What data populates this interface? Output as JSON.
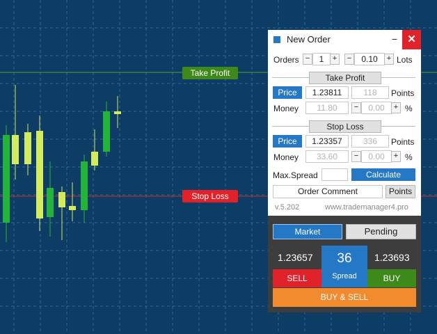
{
  "chart": {
    "background": "#0d3d64",
    "grid_color": "#2f6a92",
    "take_profit_label": "Take Profit",
    "stop_loss_label": "Stop Loss",
    "take_profit_line_color": "#4fa32d",
    "stop_loss_line_color": "#e2222a",
    "bull_color": "#22b53a",
    "bear_color": "#d4ec5c"
  },
  "panel": {
    "title": "New Order",
    "minimize_symbol": "−",
    "close_symbol": "✕",
    "orders_label": "Orders",
    "orders_value": "1",
    "lots_value": "0.10",
    "lots_label": "Lots",
    "minus": "−",
    "plus": "+",
    "take_profit": {
      "header": "Take Profit",
      "mode": "Price",
      "price": "1.23811",
      "points": "118",
      "points_label": "Points",
      "money_label": "Money",
      "money": "11.80",
      "percent": "0.00",
      "percent_label": "%"
    },
    "stop_loss": {
      "header": "Stop Loss",
      "mode": "Price",
      "price": "1.23357",
      "points": "336",
      "points_label": "Points",
      "money_label": "Money",
      "money": "33.60",
      "percent": "0.00",
      "percent_label": "%"
    },
    "max_spread_label": "Max.Spread",
    "max_spread_value": "",
    "calculate_label": "Calculate",
    "order_comment_placeholder": "Order Comment",
    "points_toggle": "Points",
    "version": "v.5.202",
    "website": "www.trademanager4.pro",
    "market_label": "Market",
    "pending_label": "Pending",
    "bid": "1.23657",
    "ask": "1.23693",
    "spread_value": "36",
    "spread_label": "Spread",
    "sell_label": "SELL",
    "buy_label": "BUY",
    "buy_sell_label": "BUY & SELL",
    "colors": {
      "accent": "#2478c6",
      "sell": "#e2222a",
      "buy": "#3d8a1b",
      "buy_sell": "#f28a2e",
      "footer": "#3d3d3d"
    }
  }
}
